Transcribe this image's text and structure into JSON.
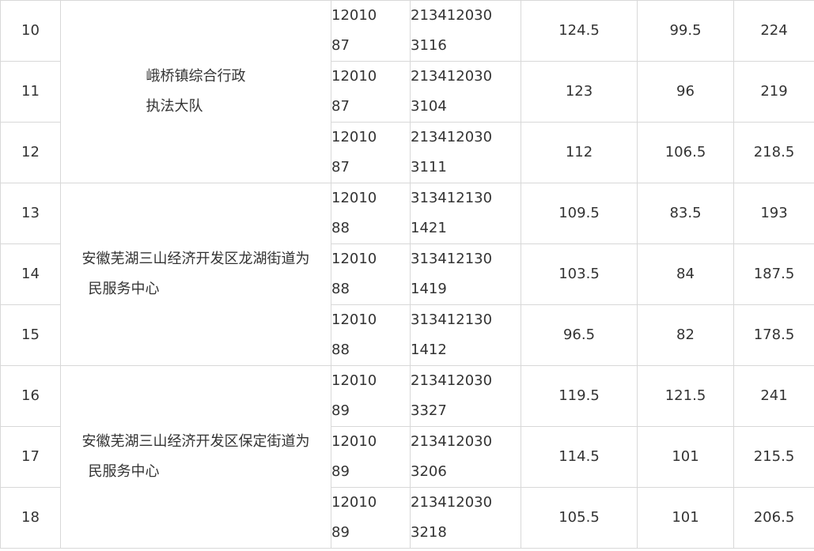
{
  "table": {
    "groups": [
      {
        "unit_line1": "峨桥镇综合行政",
        "unit_line2": "执法大队",
        "rows": [
          {
            "no": "10",
            "job_l1": "12010",
            "job_l2": "87",
            "ticket_l1": "213412030",
            "ticket_l2": "3116",
            "written": "124.5",
            "interview": "99.5",
            "total": "224"
          },
          {
            "no": "11",
            "job_l1": "12010",
            "job_l2": "87",
            "ticket_l1": "213412030",
            "ticket_l2": "3104",
            "written": "123",
            "interview": "96",
            "total": "219"
          },
          {
            "no": "12",
            "job_l1": "12010",
            "job_l2": "87",
            "ticket_l1": "213412030",
            "ticket_l2": "3111",
            "written": "112",
            "interview": "106.5",
            "total": "218.5"
          }
        ]
      },
      {
        "unit_line1": "安徽芜湖三山经济开发区龙湖街道为",
        "unit_line2": "民服务中心",
        "rows": [
          {
            "no": "13",
            "job_l1": "12010",
            "job_l2": "88",
            "ticket_l1": "313412130",
            "ticket_l2": "1421",
            "written": "109.5",
            "interview": "83.5",
            "total": "193"
          },
          {
            "no": "14",
            "job_l1": "12010",
            "job_l2": "88",
            "ticket_l1": "313412130",
            "ticket_l2": "1419",
            "written": "103.5",
            "interview": "84",
            "total": "187.5"
          },
          {
            "no": "15",
            "job_l1": "12010",
            "job_l2": "88",
            "ticket_l1": "313412130",
            "ticket_l2": "1412",
            "written": "96.5",
            "interview": "82",
            "total": "178.5"
          }
        ]
      },
      {
        "unit_line1": "安徽芜湖三山经济开发区保定街道为",
        "unit_line2": "民服务中心",
        "rows": [
          {
            "no": "16",
            "job_l1": "12010",
            "job_l2": "89",
            "ticket_l1": "213412030",
            "ticket_l2": "3327",
            "written": "119.5",
            "interview": "121.5",
            "total": "241"
          },
          {
            "no": "17",
            "job_l1": "12010",
            "job_l2": "89",
            "ticket_l1": "213412030",
            "ticket_l2": "3206",
            "written": "114.5",
            "interview": "101",
            "total": "215.5"
          },
          {
            "no": "18",
            "job_l1": "12010",
            "job_l2": "89",
            "ticket_l1": "213412030",
            "ticket_l2": "3218",
            "written": "105.5",
            "interview": "101",
            "total": "206.5"
          }
        ]
      }
    ]
  }
}
